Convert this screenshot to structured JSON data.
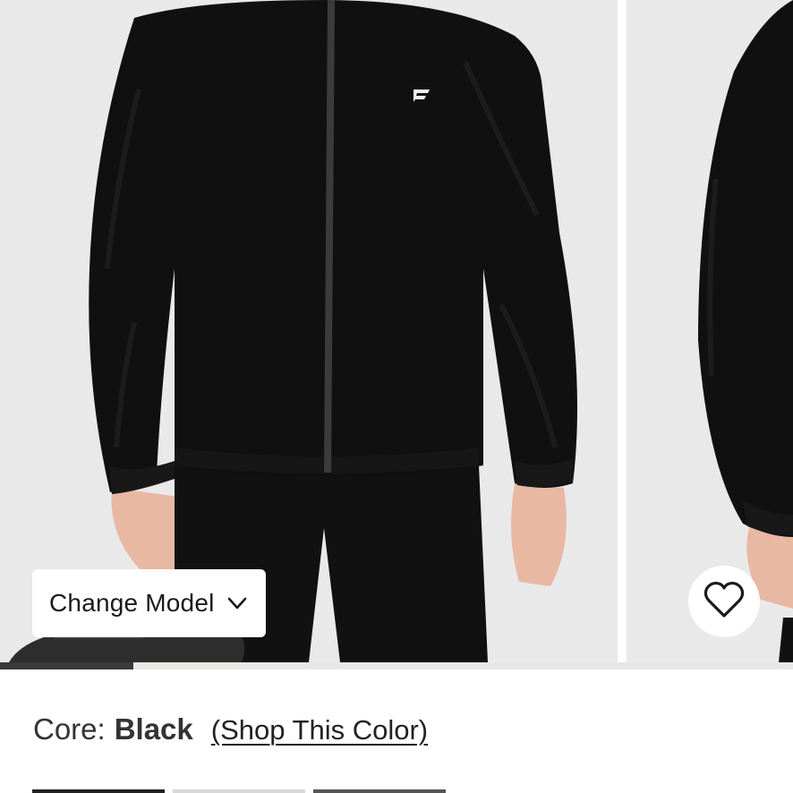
{
  "gallery": {
    "change_model_label": "Change Model",
    "progress_fraction": 0.168
  },
  "color": {
    "prefix": "Core:",
    "name": "Black",
    "shop_link": "(Shop This Color)"
  },
  "icons": {
    "change_model": "chevron-down-icon",
    "favorite": "heart-icon"
  },
  "colors": {
    "background": "#e9e9ea",
    "jacket": "#101010",
    "progress_fill": "#3a3a3a"
  }
}
